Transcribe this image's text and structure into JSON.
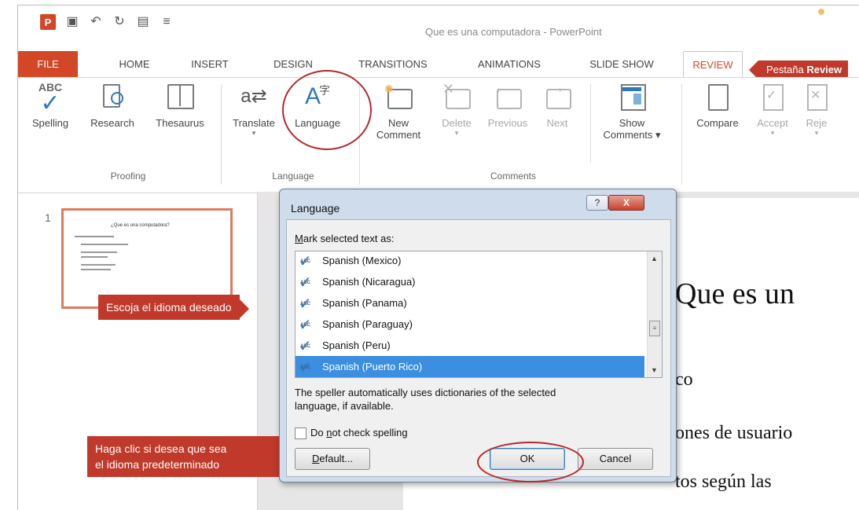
{
  "window": {
    "title": "Que es una computadora - PowerPoint"
  },
  "tabs": [
    "FILE",
    "HOME",
    "INSERT",
    "DESIGN",
    "TRANSITIONS",
    "ANIMATIONS",
    "SLIDE SHOW",
    "REVIEW"
  ],
  "review_callout": {
    "prefix": "Pestaña ",
    "bold": "Review"
  },
  "ribbon": {
    "proofing": {
      "label": "Proofing",
      "abc": "ABC",
      "spelling": "Spelling",
      "research": "Research",
      "thesaurus": "Thesaurus"
    },
    "language": {
      "label": "Language",
      "translate": "Translate",
      "language": "Language"
    },
    "comments": {
      "label": "Comments",
      "new1": "New",
      "new2": "Comment",
      "delete": "Delete",
      "previous": "Previous",
      "next": "Next",
      "show1": "Show",
      "show2": "Comments ▾"
    },
    "changes": {
      "compare": "Compare",
      "accept": "Accept",
      "reject": "Reje"
    }
  },
  "thumb": {
    "number": "1",
    "title": "¿Que es una computadora?"
  },
  "slide_text": {
    "heading": "Que es un",
    "l1": "co",
    "l2": "ones de usuario",
    "l3": "tos según las"
  },
  "callouts": {
    "language": "Escoja el idioma deseado",
    "default_line1": "Haga clic si desea que sea",
    "default_line2": "el idioma predeterminado"
  },
  "dialog": {
    "title": "Language",
    "help": "?",
    "close": "X",
    "mark_label_pre": "",
    "mark_label_u": "M",
    "mark_label_post": "ark selected text as:",
    "languages": [
      {
        "name": "Spanish (Mexico)",
        "selected": false
      },
      {
        "name": "Spanish (Nicaragua)",
        "selected": false
      },
      {
        "name": "Spanish (Panama)",
        "selected": false
      },
      {
        "name": "Spanish (Paraguay)",
        "selected": false
      },
      {
        "name": "Spanish (Peru)",
        "selected": false
      },
      {
        "name": "Spanish (Puerto Rico)",
        "selected": true
      }
    ],
    "abc_icon": "ABC",
    "info_line1": "The speller automatically uses dictionaries of the selected",
    "info_line2": "language, if available.",
    "checkbox_pre": "Do ",
    "checkbox_u": "n",
    "checkbox_post": "ot check spelling",
    "default_u": "D",
    "default_post": "efault...",
    "ok": "OK",
    "cancel": "Cancel"
  },
  "colors": {
    "accent": "#d24726",
    "callout": "#c0392b",
    "selection": "#3b8ee0"
  }
}
